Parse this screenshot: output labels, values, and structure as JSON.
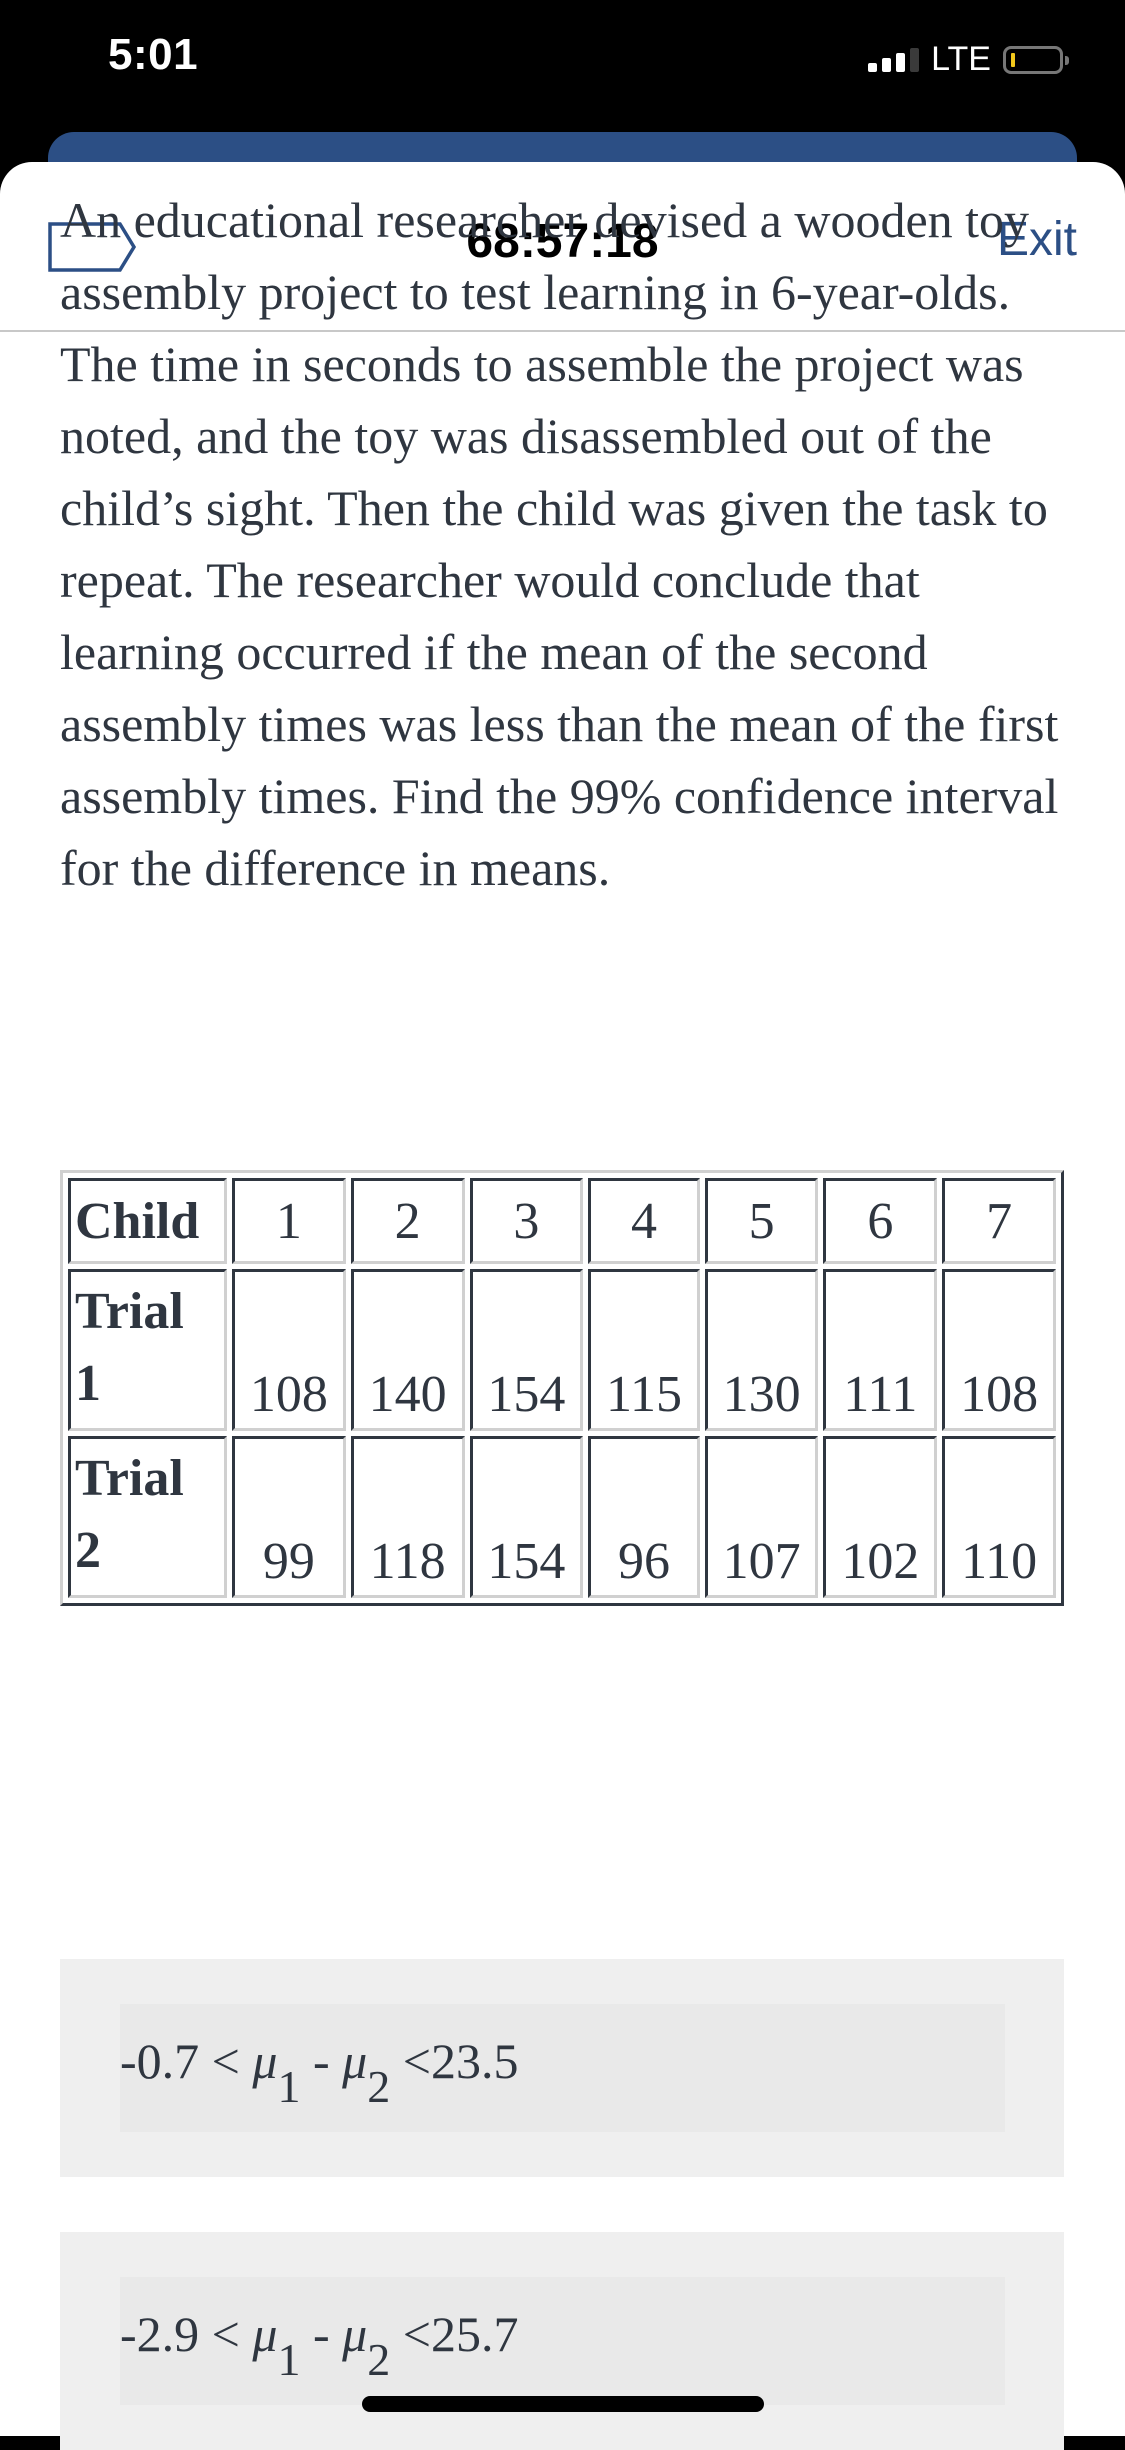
{
  "status_bar": {
    "time": "5:01",
    "network": "LTE",
    "icons": [
      "signal-icon",
      "battery-icon"
    ],
    "battery_color": "#f2c81b"
  },
  "header": {
    "flag_icon": "flag-icon",
    "timer": "68:57:18",
    "exit_label": "Exit",
    "accent_color": "#2c4f85"
  },
  "question": {
    "text": "An educational researcher devised a wooden toy assembly project to test learning in 6-year-olds. The time in seconds to assemble the project was noted, and the toy was disassembled out of the child’s sight. Then the child was given the task to repeat. The researcher would conclude that learning occurred if the mean of the second assembly times was less than the mean of the first assembly times. Find the 99% confidence interval for the difference in means."
  },
  "table": {
    "header_label": "Child",
    "children": [
      "1",
      "2",
      "3",
      "4",
      "5",
      "6",
      "7"
    ],
    "rows": [
      {
        "label": "Trial 1",
        "values": [
          "108",
          "140",
          "154",
          "115",
          "130",
          "111",
          "108"
        ]
      },
      {
        "label": "Trial 2",
        "values": [
          "99",
          "118",
          "154",
          "96",
          "107",
          "102",
          "110"
        ]
      }
    ]
  },
  "options": [
    {
      "lower": "-0.7",
      "upper": "23.5",
      "mu": "μ",
      "sub1": "1",
      "sub2": "2",
      "lt": "<",
      "minus": "-"
    },
    {
      "lower": "-2.9",
      "upper": "25.7",
      "mu": "μ",
      "sub1": "1",
      "sub2": "2",
      "lt": "<",
      "minus": "-"
    }
  ]
}
